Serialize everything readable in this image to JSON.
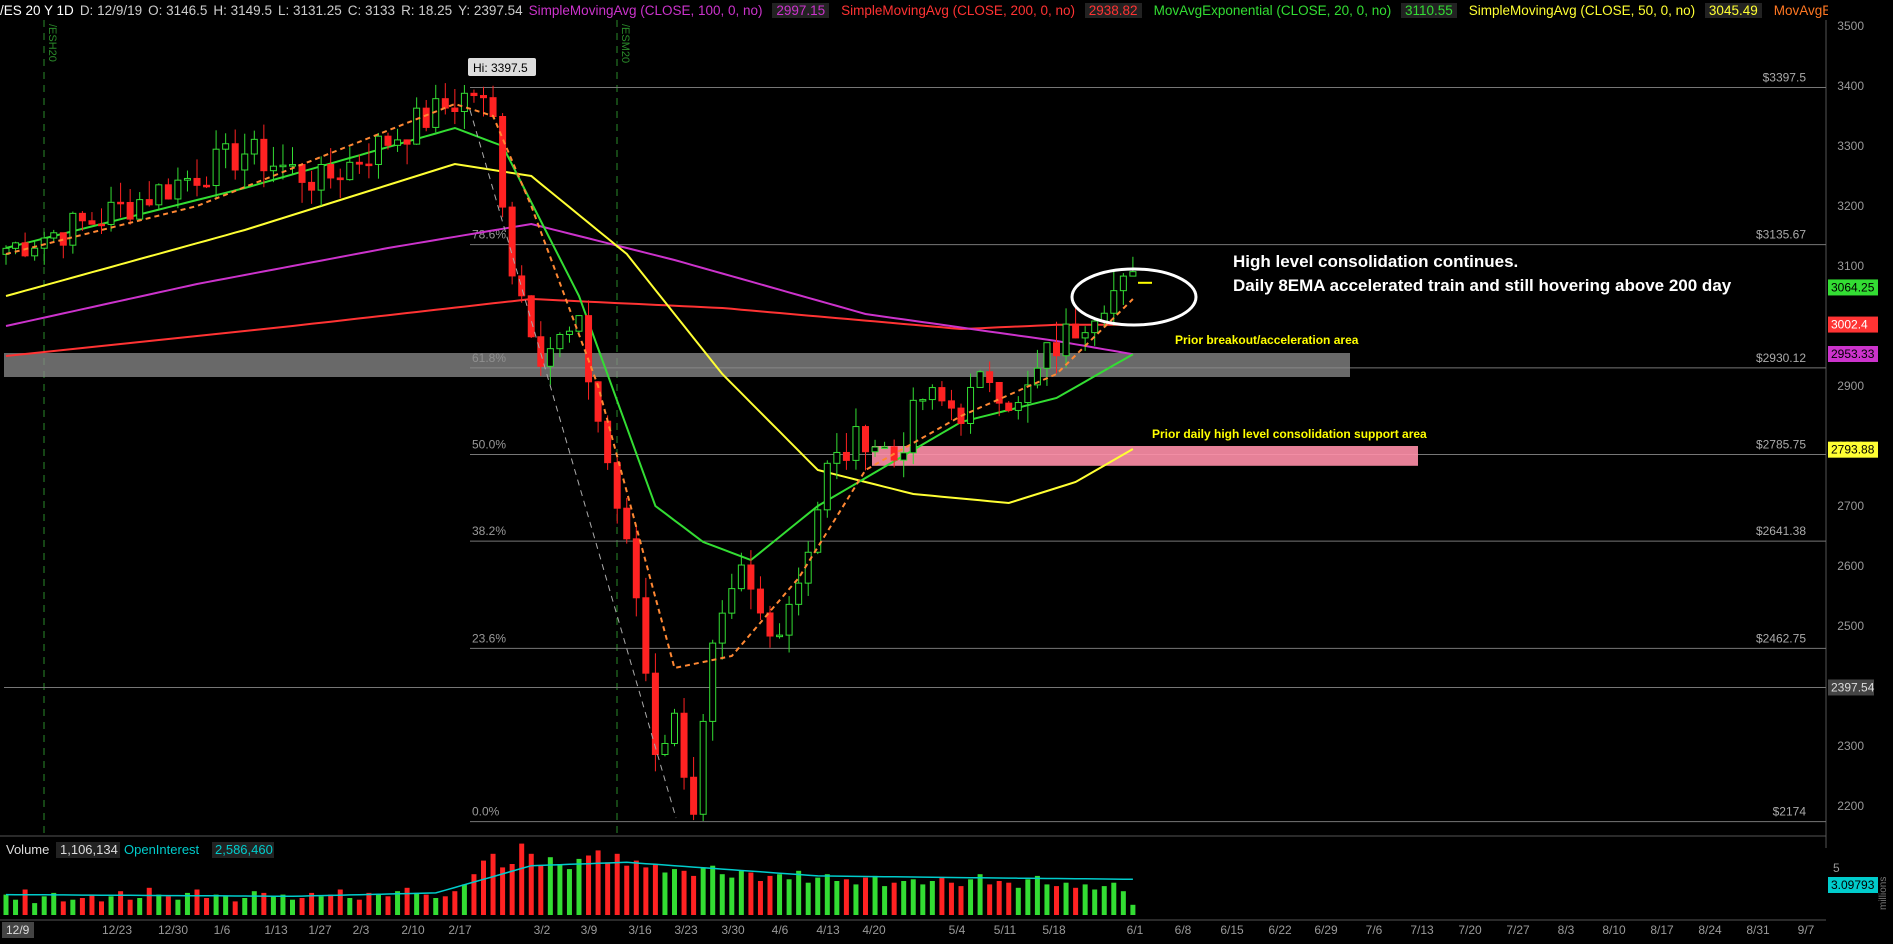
{
  "header": {
    "symbol": "/ES 20 Y 1D",
    "date": "D: 12/9/19",
    "open": "O: 3146.5",
    "high": "H: 3149.5",
    "low": "L: 3131.25",
    "close": "C: 3133",
    "range": "R: 18.25",
    "y": "Y: 2397.54",
    "studies": [
      {
        "label": "SimpleMovingAvg (CLOSE, 100, 0, no)",
        "value": "2997.15",
        "color": "#cc33cc"
      },
      {
        "label": "SimpleMovingAvg (CLOSE, 200, 0, no)",
        "value": "2938.82",
        "color": "#ff3333"
      },
      {
        "label": "MovAvgExponential (CLOSE, 20, 0, no)",
        "value": "3110.55",
        "color": "#33dd33"
      },
      {
        "label": "SimpleMovingAvg (CLOSE, 50, 0, no)",
        "value": "3045.49",
        "color": "#ffff33"
      },
      {
        "label": "MovAvgExponential ...",
        "value": "",
        "color": "#ff7722"
      }
    ]
  },
  "colors": {
    "up": "#33dd33",
    "down": "#ff2222",
    "ema8": "#ff8833",
    "sma100": "#cc33cc",
    "sma200": "#ff3333",
    "ema20": "#33dd33",
    "sma50": "#ffff33",
    "annotation": "#ffff00",
    "volume_avg": "#00cccc"
  },
  "contract_markers": [
    "/ESH20",
    "/ESM20"
  ],
  "hi_label": "Hi: 3397.5",
  "fib_levels": [
    {
      "pct": "78.6%",
      "value": 3135.67,
      "label": "$3135.67"
    },
    {
      "pct": "61.8%",
      "value": 2930.12,
      "label": "$2930.12"
    },
    {
      "pct": "50.0%",
      "value": 2785.75,
      "label": "$2785.75"
    },
    {
      "pct": "38.2%",
      "value": 2641.38,
      "label": "$2641.38"
    },
    {
      "pct": "23.6%",
      "value": 2462.75,
      "label": "$2462.75"
    },
    {
      "pct": "0.0%",
      "value": 2174,
      "label": "$2174"
    }
  ],
  "top_level": {
    "value": 3397.5,
    "label": "$3397.5"
  },
  "y_level": {
    "value": 2397.54,
    "label": "2397.54"
  },
  "price_badges": [
    {
      "value": 3064.25,
      "label": "3064.25",
      "color": "#33dd33"
    },
    {
      "value": 3002.4,
      "label": "3002.4",
      "color": "#ff3333"
    },
    {
      "value": 2953.33,
      "label": "2953.33",
      "color": "#cc33cc"
    },
    {
      "value": 2793.88,
      "label": "2793.88",
      "color": "#ffff33"
    }
  ],
  "annotations": {
    "main_line1": "High level consolidation continues.",
    "main_line2": "Daily 8EMA accelerated train and still hovering above 200 day",
    "zone1": "Prior breakout/acceleration area",
    "zone2": "Prior daily high level consolidation support area"
  },
  "volume_panel": {
    "label": "Volume",
    "value": "1,106,134",
    "oi_label": "OpenInterest",
    "oi_value": "2,586,460",
    "badge": "3.09793",
    "scale_top": "5",
    "unit": "millions"
  },
  "bottom_left_date": "12/9",
  "chart_data": {
    "type": "candlestick",
    "y_ticks": [
      3500,
      3400,
      3300,
      3200,
      3100,
      3000,
      2900,
      2800,
      2700,
      2600,
      2500,
      2400,
      2300,
      2200
    ],
    "ylim": [
      2150,
      3510
    ],
    "x_ticks": [
      "12/23",
      "12/30",
      "1/6",
      "1/13",
      "1/27",
      "2/3",
      "2/10",
      "2/17",
      "3/2",
      "3/9",
      "3/16",
      "3/23",
      "3/30",
      "4/6",
      "4/13",
      "4/20",
      "5/4",
      "5/11",
      "5/18",
      "6/1",
      "6/8",
      "6/15",
      "6/22",
      "6/29",
      "7/6",
      "7/13",
      "7/20",
      "7/27",
      "8/3",
      "8/10",
      "8/17",
      "8/24",
      "8/31",
      "9/7"
    ],
    "price_anchors": [
      [
        0,
        3130
      ],
      [
        9,
        3175
      ],
      [
        16,
        3225
      ],
      [
        25,
        3290
      ],
      [
        33,
        3240
      ],
      [
        40,
        3310
      ],
      [
        46,
        3365
      ],
      [
        49,
        3390
      ],
      [
        51,
        3340
      ],
      [
        53,
        3100
      ],
      [
        56,
        2960
      ],
      [
        60,
        2990
      ],
      [
        64,
        2700
      ],
      [
        66,
        2550
      ],
      [
        68,
        2300
      ],
      [
        70,
        2340
      ],
      [
        72,
        2200
      ],
      [
        74,
        2450
      ],
      [
        77,
        2580
      ],
      [
        80,
        2480
      ],
      [
        83,
        2580
      ],
      [
        86,
        2760
      ],
      [
        90,
        2820
      ],
      [
        93,
        2780
      ],
      [
        96,
        2880
      ],
      [
        100,
        2860
      ],
      [
        103,
        2920
      ],
      [
        106,
        2860
      ],
      [
        109,
        2950
      ],
      [
        112,
        3000
      ],
      [
        115,
        3050
      ],
      [
        118,
        3070
      ]
    ],
    "ma_sma100": [
      [
        0,
        3000
      ],
      [
        20,
        3070
      ],
      [
        40,
        3130
      ],
      [
        55,
        3170
      ],
      [
        70,
        3110
      ],
      [
        90,
        3020
      ],
      [
        110,
        2975
      ],
      [
        118,
        2953
      ]
    ],
    "ma_sma200": [
      [
        0,
        2950
      ],
      [
        30,
        3000
      ],
      [
        55,
        3045
      ],
      [
        75,
        3030
      ],
      [
        100,
        2995
      ],
      [
        110,
        3002
      ],
      [
        118,
        3002
      ]
    ],
    "ma_ema20": [
      [
        0,
        3130
      ],
      [
        25,
        3230
      ],
      [
        47,
        3330
      ],
      [
        52,
        3300
      ],
      [
        60,
        3050
      ],
      [
        68,
        2700
      ],
      [
        73,
        2640
      ],
      [
        78,
        2610
      ],
      [
        85,
        2700
      ],
      [
        100,
        2840
      ],
      [
        110,
        2880
      ],
      [
        118,
        2953
      ]
    ],
    "ma_sma50": [
      [
        0,
        3050
      ],
      [
        25,
        3160
      ],
      [
        47,
        3270
      ],
      [
        55,
        3250
      ],
      [
        65,
        3120
      ],
      [
        75,
        2920
      ],
      [
        85,
        2760
      ],
      [
        95,
        2720
      ],
      [
        105,
        2705
      ],
      [
        112,
        2740
      ],
      [
        118,
        2795
      ]
    ],
    "ema8_anchors": [
      [
        0,
        3120
      ],
      [
        20,
        3200
      ],
      [
        47,
        3370
      ],
      [
        51,
        3350
      ],
      [
        55,
        3200
      ],
      [
        62,
        2900
      ],
      [
        70,
        2430
      ],
      [
        76,
        2450
      ],
      [
        83,
        2580
      ],
      [
        90,
        2760
      ],
      [
        100,
        2850
      ],
      [
        110,
        2920
      ],
      [
        118,
        3045
      ]
    ],
    "volume": [
      1.2,
      0.9,
      1.5,
      0.7,
      1.1,
      1.3,
      0.8,
      0.9,
      1.0,
      1.2,
      0.8,
      1.1,
      1.4,
      0.9,
      1.0,
      1.6,
      1.2,
      1.1,
      0.9,
      1.3,
      1.5,
      1.0,
      1.2,
      1.1,
      0.8,
      1.0,
      1.4,
      1.3,
      1.1,
      1.2,
      0.9,
      1.0,
      1.3,
      1.1,
      1.2,
      1.5,
      1.0,
      0.9,
      1.3,
      1.2,
      1.1,
      1.4,
      1.6,
      1.3,
      1.2,
      1.0,
      1.1,
      1.4,
      1.8,
      2.4,
      3.2,
      3.6,
      2.8,
      3.0,
      4.2,
      3.6,
      2.9,
      3.4,
      3.0,
      2.7,
      3.3,
      3.5,
      3.8,
      3.1,
      3.6,
      2.9,
      3.2,
      2.8,
      3.0,
      2.5,
      2.7,
      2.6,
      2.3,
      2.8,
      2.9,
      2.4,
      2.2,
      2.6,
      2.5,
      2.0,
      2.3,
      2.4,
      2.1,
      2.6,
      1.9,
      2.2,
      2.4,
      2.0,
      2.1,
      1.8,
      2.2,
      2.3,
      1.7,
      1.9,
      2.0,
      2.1,
      1.8,
      2.0,
      2.2,
      1.9,
      1.7,
      2.1,
      2.4,
      1.8,
      2.0,
      1.9,
      1.6,
      2.1,
      2.3,
      1.8,
      1.7,
      1.9,
      1.6,
      1.8,
      1.5,
      1.7,
      1.9,
      1.4,
      0.6
    ],
    "volume_avg": [
      [
        0,
        1.2
      ],
      [
        30,
        1.1
      ],
      [
        45,
        1.3
      ],
      [
        55,
        2.9
      ],
      [
        65,
        3.1
      ],
      [
        75,
        2.7
      ],
      [
        85,
        2.3
      ],
      [
        100,
        2.2
      ],
      [
        118,
        2.1
      ]
    ]
  }
}
